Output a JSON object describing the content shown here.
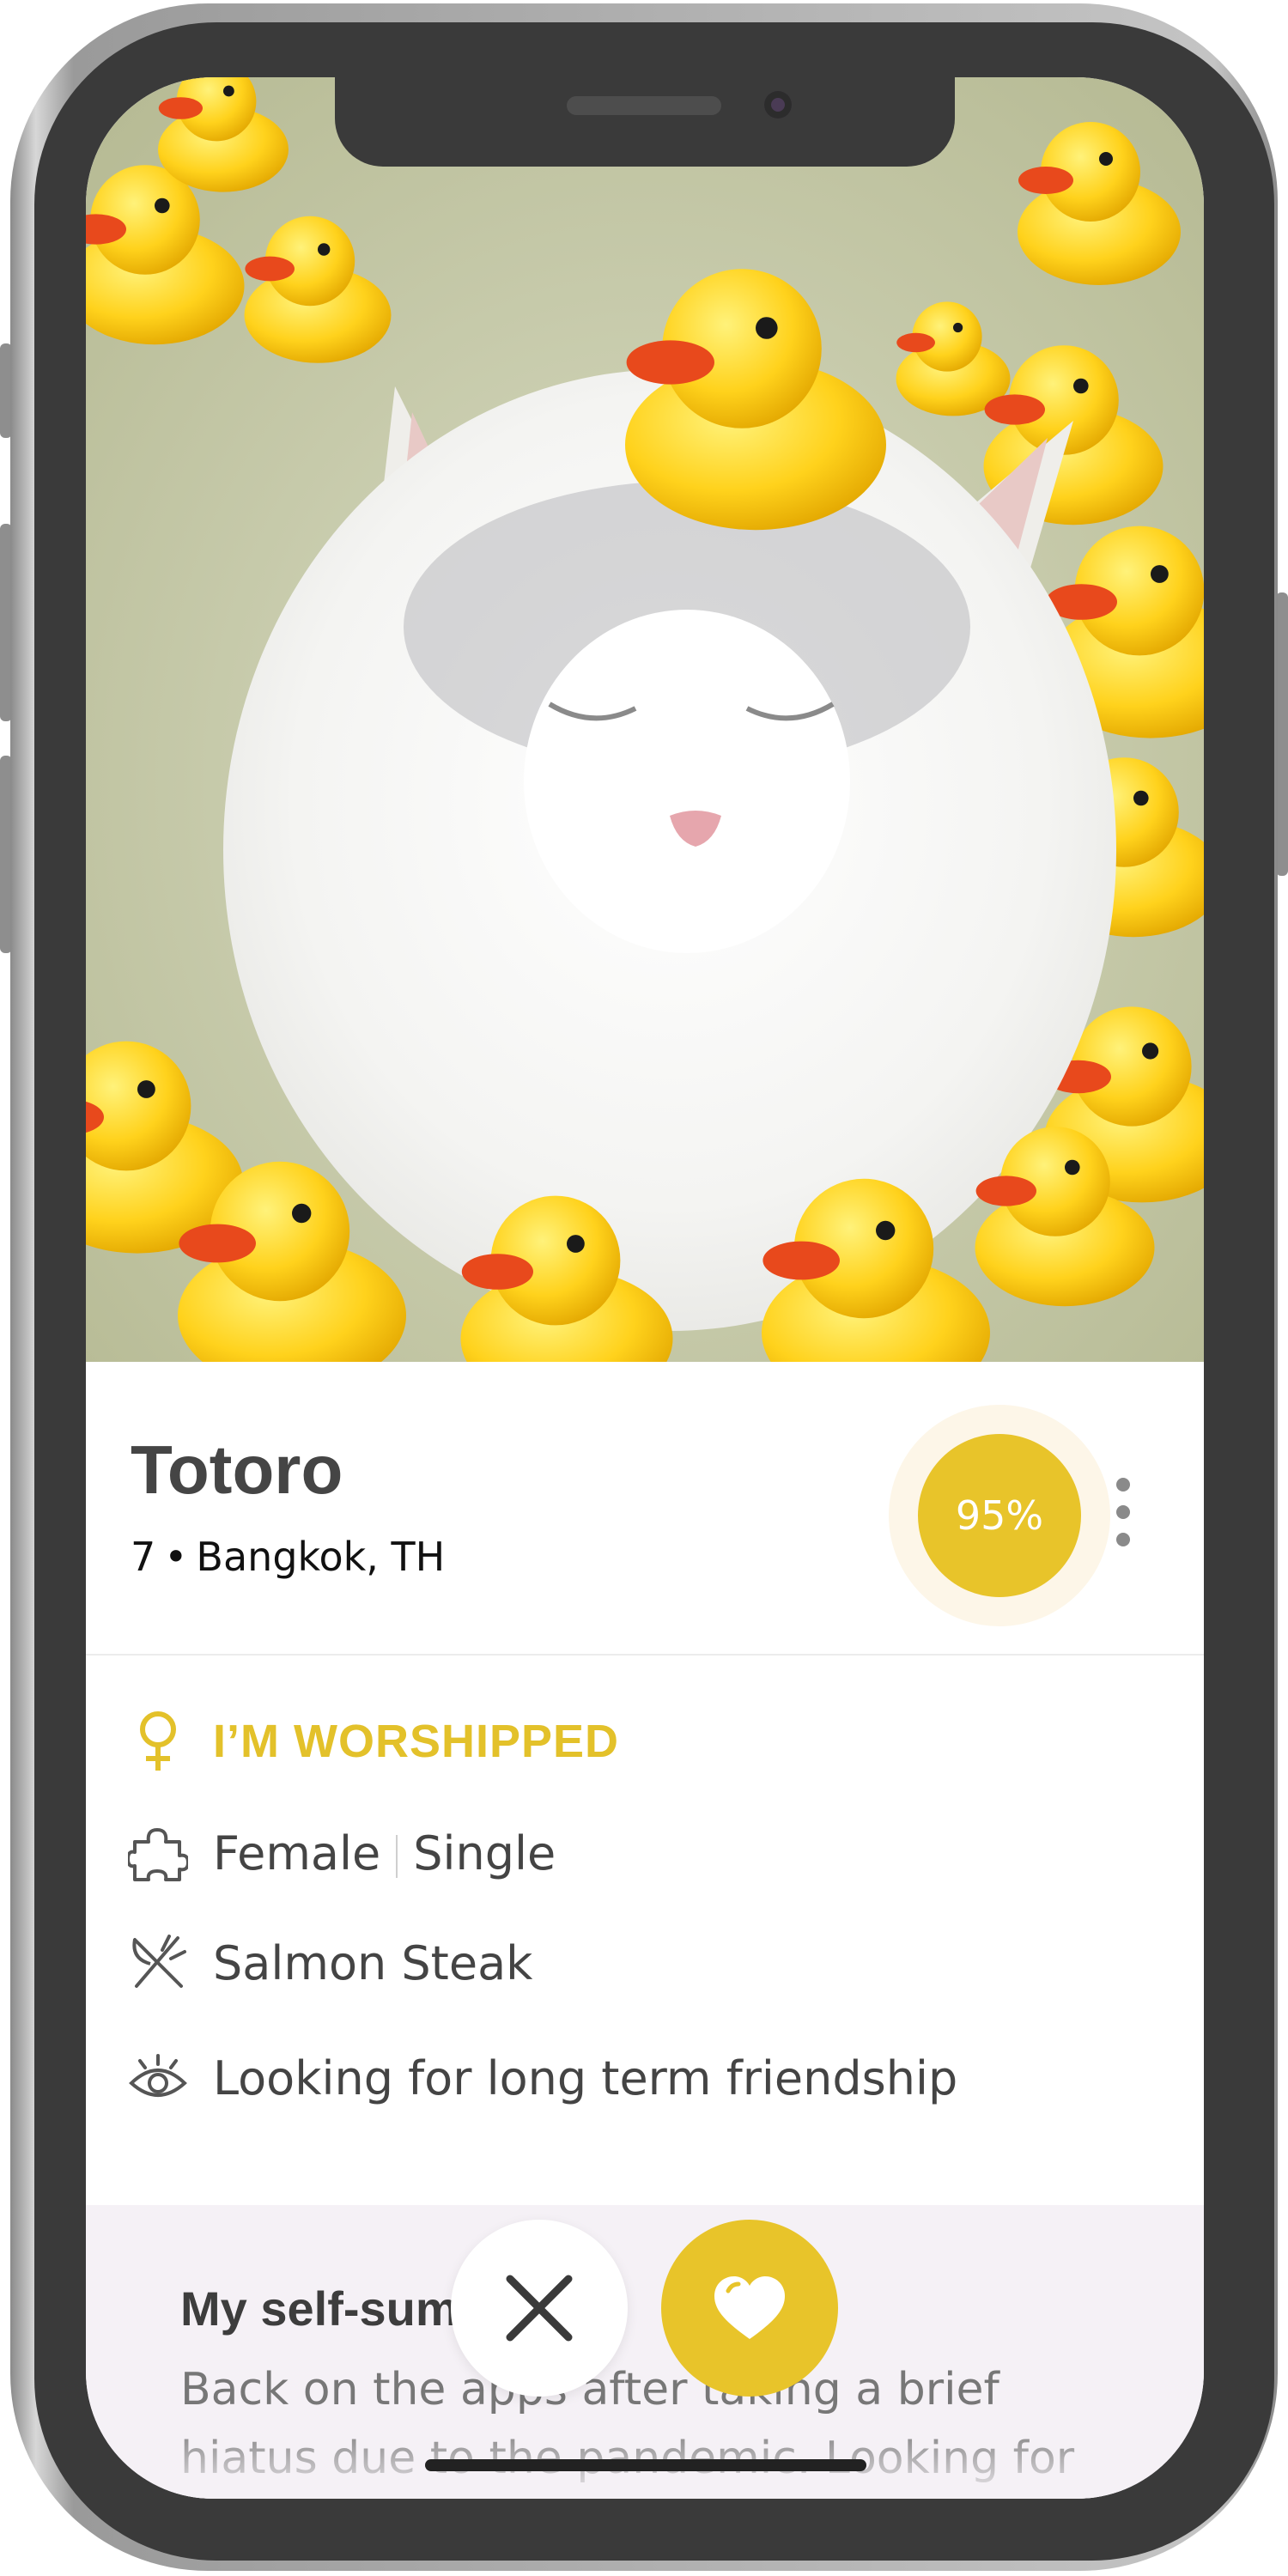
{
  "profile": {
    "name": "Totoro",
    "age": "7",
    "separator": "•",
    "location": "Bangkok, TH",
    "match_percent": "95%"
  },
  "details": {
    "role": "I’M WORSHIPPED",
    "gender": "Female",
    "relationship": "Single",
    "food": "Salmon Steak",
    "looking_for": "Looking for long term friendship"
  },
  "bio": {
    "title": "My self-summary",
    "text": "Back on the apps after taking a brief hiatus due to the pandemic. Looking for"
  },
  "icons": {
    "role": "female-symbol-icon",
    "gender": "puzzle-icon",
    "food": "fork-knife-icon",
    "looking_for": "eye-icon",
    "more": "more-vertical-icon",
    "pass": "close-icon",
    "like": "heart-icon"
  },
  "colors": {
    "accent": "#e8c42a",
    "text_dark": "#454545",
    "bio_background": "#f5f1f6"
  }
}
